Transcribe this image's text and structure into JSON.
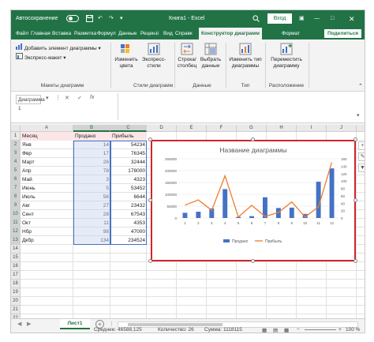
{
  "titlebar": {
    "autosave_label": "Автосохранение",
    "autosave_state": "off",
    "window_title": "Книга1  -  Excel",
    "login_label": "Вход",
    "accent_color": "#217346"
  },
  "tabs": {
    "items": [
      "Файл",
      "Главная",
      "Вставка",
      "Разметка",
      "Формул",
      "Данные",
      "Рецензі",
      "Вид",
      "Справк",
      "Конструктор диаграмм",
      "Формат"
    ],
    "active": "Конструктор диаграмм",
    "share_label": "Поделиться"
  },
  "ribbon": {
    "add_element": "Добавить элемент диаграммы",
    "express_layout": "Экспресс-макет",
    "change_colors": "Изменить цвета",
    "express_styles": "Экспресс-стили",
    "row_col": "Строка/столбец",
    "select_data": "Выбрать данные",
    "change_type": "Изменить тип диаграммы",
    "move_chart": "Переместить диаграмму",
    "groups": {
      "layouts": "Макеты диаграмм",
      "styles": "Стили диаграмм",
      "data": "Данные",
      "type": "Тип",
      "location": "Расположение"
    }
  },
  "formula_bar": {
    "name_box": "Диаграмма 1",
    "fx_icon": "function-icon",
    "value": ""
  },
  "sheet": {
    "columns": [
      "A",
      "B",
      "C",
      "D",
      "E",
      "F",
      "G",
      "H",
      "I",
      "J",
      "K"
    ],
    "rows": [
      "1",
      "2",
      "3",
      "4",
      "5",
      "6",
      "7",
      "8",
      "9",
      "10",
      "11",
      "12",
      "13",
      "14",
      "15",
      "16",
      "17",
      "18",
      "19",
      "20",
      "21",
      "22"
    ],
    "headers": [
      "Месяц",
      "Продано",
      "Прибыль"
    ],
    "data": [
      [
        "Янв",
        "14",
        "54234"
      ],
      [
        "Фвр",
        "17",
        "76345"
      ],
      [
        "Март",
        "26",
        "32444"
      ],
      [
        "Апр",
        "78",
        "178000"
      ],
      [
        "Май",
        "3",
        "4323"
      ],
      [
        "Июнь",
        "5",
        "53452"
      ],
      [
        "Июль",
        "56",
        "6644"
      ],
      [
        "Авг",
        "27",
        "23432"
      ],
      [
        "Сент",
        "28",
        "67543"
      ],
      [
        "Окт",
        "11",
        "4353"
      ],
      [
        "Нбр",
        "98",
        "47000"
      ],
      [
        "Дкбр",
        "134",
        "234524"
      ]
    ]
  },
  "chart_data": {
    "type": "bar",
    "title": "Название диаграммы",
    "categories": [
      "1",
      "2",
      "3",
      "4",
      "5",
      "6",
      "7",
      "8",
      "9",
      "10",
      "11",
      "12"
    ],
    "series": [
      {
        "name": "Продано",
        "kind": "bar",
        "axis": "right",
        "color": "#4472c4",
        "values": [
          14,
          17,
          26,
          78,
          3,
          5,
          56,
          27,
          28,
          11,
          98,
          134
        ]
      },
      {
        "name": "Прибыль",
        "kind": "line",
        "axis": "left",
        "color": "#ed7d31",
        "values": [
          54234,
          76345,
          32444,
          178000,
          4323,
          53452,
          6644,
          23432,
          67543,
          4353,
          47000,
          234524
        ]
      }
    ],
    "ylim_left": [
      0,
      250000
    ],
    "yticks_left": [
      "0",
      "50000",
      "100000",
      "150000",
      "200000",
      "250000"
    ],
    "ylim_right": [
      0,
      160
    ],
    "yticks_right": [
      "0",
      "20",
      "40",
      "60",
      "80",
      "100",
      "120",
      "140",
      "160"
    ],
    "legend_position": "bottom",
    "grid": true
  },
  "sheet_tabs": {
    "active": "Лист1",
    "add_icon": "plus-icon"
  },
  "status_bar": {
    "average": "Среднее: 46588,125",
    "count": "Количество: 26",
    "sum": "Сумма: 1118115",
    "zoom": "100 %"
  }
}
